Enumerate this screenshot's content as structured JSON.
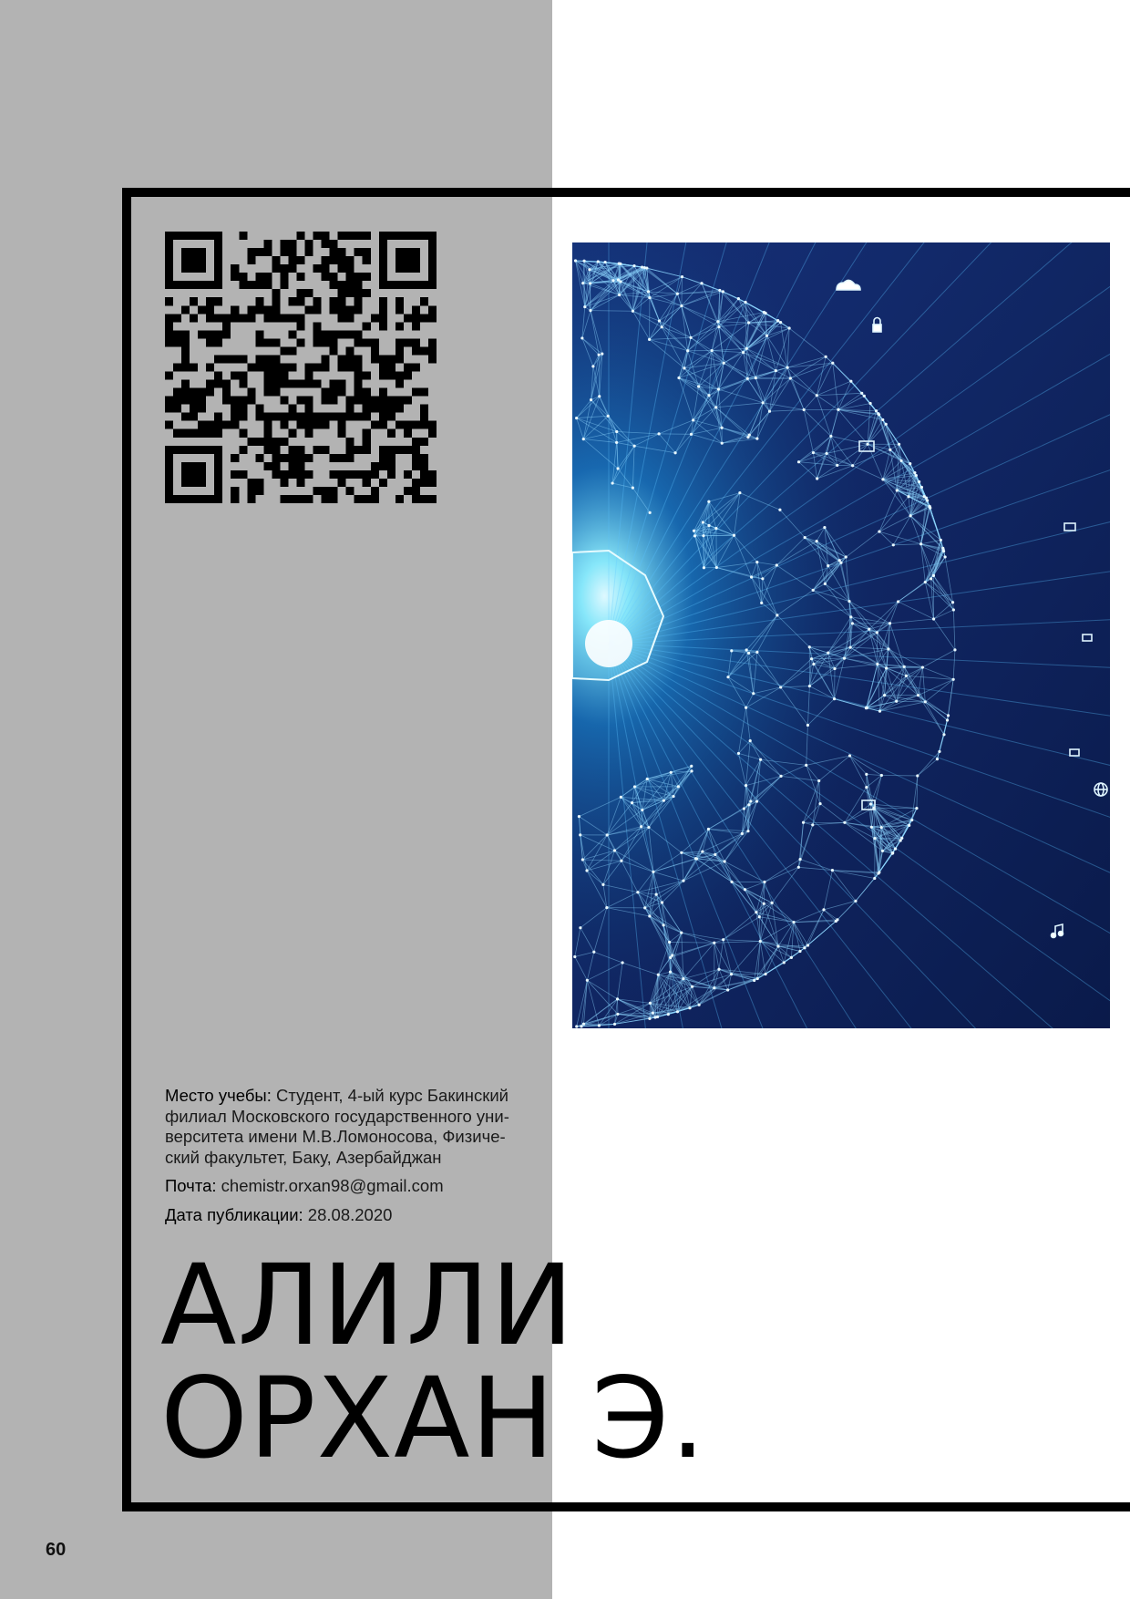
{
  "author": {
    "surname": "АЛИЛИ",
    "given": "ОРХАН Э."
  },
  "info": {
    "study_label": "Место учебы:",
    "study_value": " Студент, 4-ый курс Бакинский филиал Московского государственного уни-верситета имени М.В.Ломоносова, Физиче-ский факультет, Баку, Азербайджан",
    "email_label": "Почта:",
    "email_value": " chemistr.orxan98@gmail.com",
    "date_label": "Дата публикации:",
    "date_value": " 28.08.2020"
  },
  "page_number": "60",
  "colors": {
    "side_band": "#b3b3b3",
    "frame": "#000000",
    "hero_bg": "#0c2159",
    "hero_glow": "#4fd3ff"
  },
  "icons": [
    "qr-code-icon",
    "cloud-icon",
    "lock-icon",
    "monitor-icon",
    "globe-icon",
    "music-note-icon"
  ]
}
